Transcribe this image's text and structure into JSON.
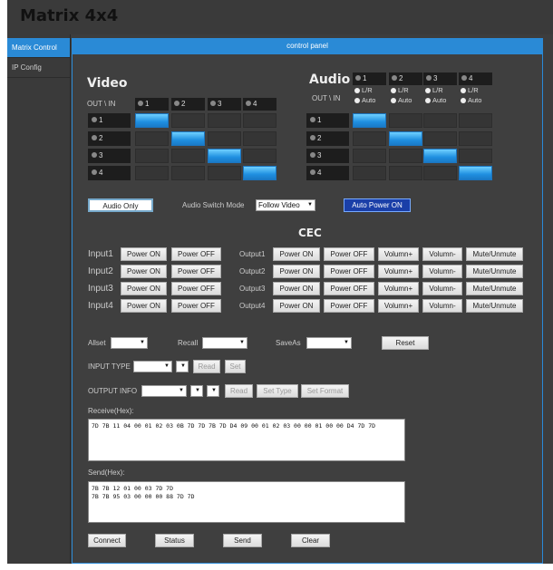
{
  "app": {
    "title": "Matrix 4x4"
  },
  "sidebar": {
    "items": [
      {
        "label": "Matrix Control"
      },
      {
        "label": "IP Config"
      }
    ]
  },
  "panel": {
    "title": "control panel"
  },
  "video": {
    "title": "Video",
    "corner": "OUT \\ IN",
    "inputs": [
      "1",
      "2",
      "3",
      "4"
    ],
    "outputs": [
      "1",
      "2",
      "3",
      "4"
    ],
    "routes": [
      0,
      1,
      2,
      3
    ]
  },
  "audio": {
    "title": "Audio",
    "corner": "OUT \\ IN",
    "inputs": [
      "1",
      "2",
      "3",
      "4"
    ],
    "outputs": [
      "1",
      "2",
      "3",
      "4"
    ],
    "routes": [
      0,
      1,
      2,
      3
    ],
    "radio_lr": "L/R",
    "radio_auto": "Auto"
  },
  "controls": {
    "audio_only": "Audio Only",
    "switch_mode_label": "Audio Switch Mode",
    "switch_mode_value": "Follow Video",
    "auto_power": "Auto Power ON"
  },
  "cec": {
    "title": "CEC",
    "inputs": [
      "Input1",
      "Input2",
      "Input3",
      "Input4"
    ],
    "outputs": [
      "Output1",
      "Output2",
      "Output3",
      "Output4"
    ],
    "power_on": "Power ON",
    "power_off": "Power OFF",
    "vol_up": "Volumn+",
    "vol_down": "Volumn-",
    "mute": "Mute/Unmute"
  },
  "presets": {
    "allset": "Allset",
    "recall": "Recall",
    "saveas": "SaveAs",
    "reset": "Reset"
  },
  "input_type": {
    "label": "INPUT TYPE",
    "read": "Read",
    "set": "Set"
  },
  "output_info": {
    "label": "OUTPUT INFO",
    "read": "Read",
    "set_type": "Set Type",
    "set_format": "Set Format"
  },
  "receive": {
    "label": "Receive(Hex):",
    "value": "7D 7B 11 04 00 01 02 03 0B 7D 7D 7B 7D D4 09 00 01 02 03 00 00 01 00 00 D4 7D 7D"
  },
  "send": {
    "label": "Send(Hex):",
    "value": "7B 7B 12 01 00 03 7D 7D\n7B 7B 95 03 00 00 00 88 7D 7D"
  },
  "actions": {
    "connect": "Connect",
    "status": "Status",
    "send": "Send",
    "clear": "Clear"
  }
}
